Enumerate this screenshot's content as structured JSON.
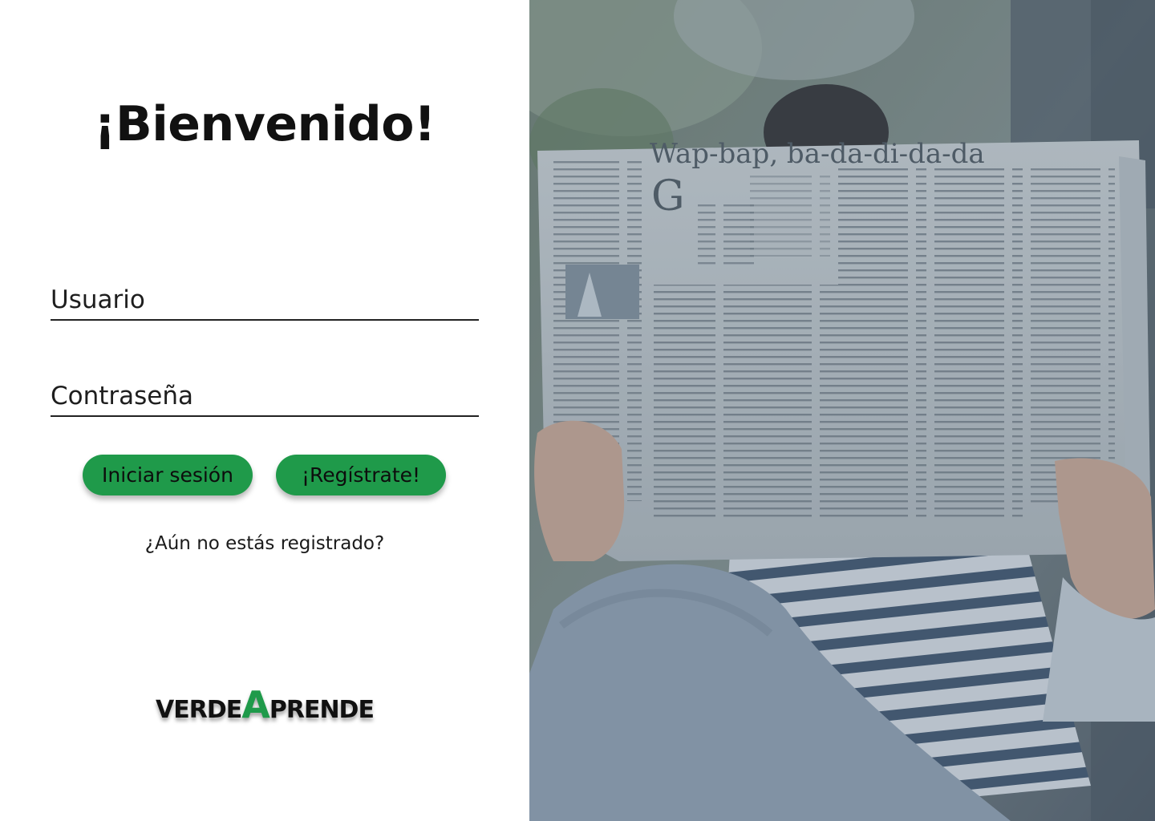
{
  "welcome": {
    "title": "¡Bienvenido!"
  },
  "form": {
    "username_placeholder": "Usuario",
    "password_placeholder": "Contraseña",
    "login_button": "Iniciar sesión",
    "register_button": "¡Regístrate!",
    "not_registered_text": "¿Aún no estás registrado?"
  },
  "logo": {
    "part1": "VERDE",
    "part2": "A",
    "part3": "PRENDE"
  },
  "hero": {
    "headline": "Wap-bap, ba-da-di-da-da",
    "drop_cap": "G"
  },
  "colors": {
    "accent": "#1f9a4a",
    "text": "#111111",
    "overlay": "#5b6e80"
  },
  "icons": [
    "newspaper-photo"
  ]
}
